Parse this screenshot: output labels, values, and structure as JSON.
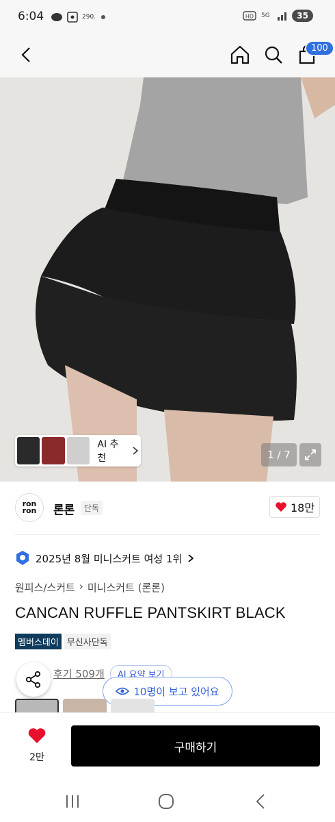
{
  "status_bar": {
    "time": "6:04",
    "left_icons": [
      "talk-icon",
      "screenshot-icon",
      "dots-icon"
    ],
    "small_text": "290.",
    "battery": "35"
  },
  "nav": {
    "cart_count": "100"
  },
  "hero": {
    "ai_recommend_label": "AI 추천",
    "image_counter": "1 / 7"
  },
  "brand": {
    "logo_text": "ron ron",
    "name": "론론",
    "tag": "단독",
    "likes": "18만"
  },
  "rank": {
    "text": "2025년 8월 미니스커트 여성 1위"
  },
  "breadcrumb": {
    "category": "원피스/스커트",
    "subcategory": "미니스커트 (론론)"
  },
  "product": {
    "title": "CANCAN RUFFLE PANTSKIRT BLACK",
    "badges": [
      "멤버스데이",
      "무신사단독"
    ]
  },
  "reviews": {
    "count_label": "후기 509개",
    "ai_summary_label": "AI 요약 보기",
    "viewing_label": "10명이 보고 있어요"
  },
  "bottom": {
    "like_count": "2만",
    "buy_label": "구매하기"
  },
  "colors": {
    "accent_blue": "#2f6fe0",
    "badge_navy": "#0f3b5c",
    "heart_red": "#e8112d",
    "buy_black": "#000000"
  }
}
